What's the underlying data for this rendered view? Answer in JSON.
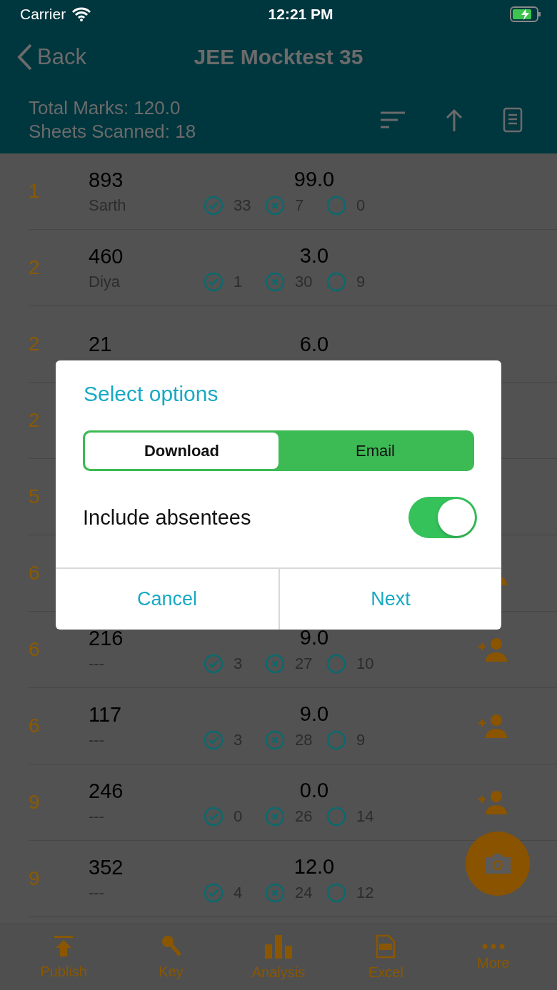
{
  "status_bar": {
    "carrier": "Carrier",
    "time": "12:21 PM"
  },
  "nav": {
    "back": "Back",
    "title": "JEE Mocktest 35"
  },
  "summary": {
    "total_marks": "Total Marks: 120.0",
    "sheets_scanned": "Sheets Scanned: 18"
  },
  "rows": [
    {
      "rank": "1",
      "roll": "893",
      "name": "Sarth",
      "score": "99.0",
      "counts": [
        {
          "kind": "correct",
          "value": "33"
        },
        {
          "kind": "wrong",
          "value": "7"
        },
        {
          "kind": "unattempted",
          "value": "0"
        }
      ],
      "add_student": false
    },
    {
      "rank": "2",
      "roll": "460",
      "name": "Diya",
      "score": "3.0",
      "counts": [
        {
          "kind": "correct",
          "value": "1"
        },
        {
          "kind": "wrong",
          "value": "30"
        },
        {
          "kind": "unattempted",
          "value": "9"
        }
      ],
      "add_student": false
    },
    {
      "rank": "2",
      "roll": "21",
      "score": "6.0",
      "add_student": false
    },
    {
      "rank": "2",
      "add_student": false
    },
    {
      "rank": "5",
      "add_student": false
    },
    {
      "rank": "6",
      "add_student": true
    },
    {
      "rank": "6",
      "roll": "216",
      "name": "---",
      "score": "9.0",
      "counts": [
        {
          "kind": "correct",
          "value": "3"
        },
        {
          "kind": "wrong",
          "value": "27"
        },
        {
          "kind": "unattempted",
          "value": "10"
        }
      ],
      "add_student": true
    },
    {
      "rank": "6",
      "roll": "117",
      "name": "---",
      "score": "9.0",
      "counts": [
        {
          "kind": "correct",
          "value": "3"
        },
        {
          "kind": "wrong",
          "value": "28"
        },
        {
          "kind": "unattempted",
          "value": "9"
        }
      ],
      "add_student": true
    },
    {
      "rank": "9",
      "roll": "246",
      "name": "---",
      "score": "0.0",
      "counts": [
        {
          "kind": "correct",
          "value": "0"
        },
        {
          "kind": "wrong",
          "value": "26"
        },
        {
          "kind": "unattempted",
          "value": "14"
        }
      ],
      "add_student": true
    },
    {
      "rank": "9",
      "roll": "352",
      "name": "---",
      "score": "12.0",
      "counts": [
        {
          "kind": "correct",
          "value": "4"
        },
        {
          "kind": "wrong",
          "value": "24"
        },
        {
          "kind": "unattempted",
          "value": "12"
        }
      ]
    }
  ],
  "tabs": [
    {
      "kind": "publish",
      "label": "Publish"
    },
    {
      "kind": "key",
      "label": "Key"
    },
    {
      "kind": "analysis",
      "label": "Analysis"
    },
    {
      "kind": "excel",
      "label": "Excel"
    },
    {
      "kind": "more",
      "label": "More"
    }
  ],
  "dialog": {
    "title": "Select options",
    "segments": [
      {
        "label": "Download",
        "selected": true
      },
      {
        "label": "Email",
        "selected": false
      }
    ],
    "toggle": {
      "label": "Include absentees",
      "on": true
    },
    "buttons": [
      "Cancel",
      "Next"
    ]
  }
}
